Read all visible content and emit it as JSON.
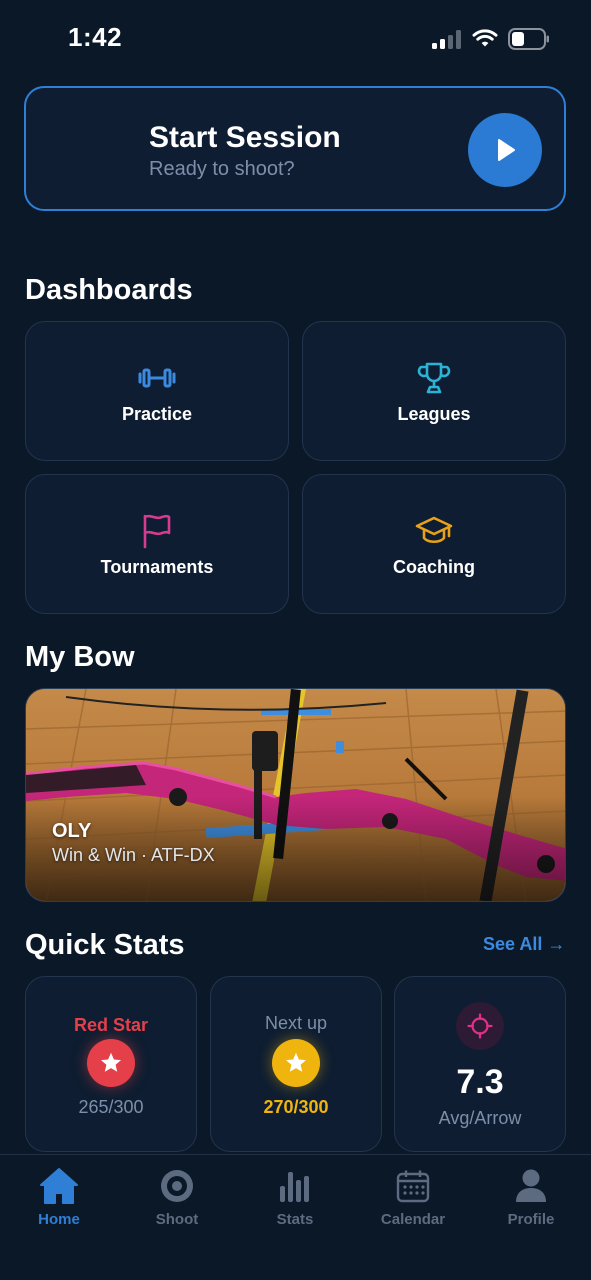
{
  "status_bar": {
    "time": "1:42"
  },
  "start_session": {
    "title": "Start Session",
    "subtitle": "Ready to shoot?"
  },
  "dashboards": {
    "title": "Dashboards",
    "items": [
      {
        "label": "Practice",
        "icon": "dumbbell-icon",
        "color": "#3b8ae0"
      },
      {
        "label": "Leagues",
        "icon": "trophy-icon",
        "color": "#2bb3d6"
      },
      {
        "label": "Tournaments",
        "icon": "flag-icon",
        "color": "#d63b8f"
      },
      {
        "label": "Coaching",
        "icon": "graduation-cap-icon",
        "color": "#e8a21a"
      }
    ]
  },
  "my_bow": {
    "title": "My Bow",
    "name": "OLY",
    "detail": "Win & Win · ATF-DX"
  },
  "quick_stats": {
    "title": "Quick Stats",
    "see_all": "See All →",
    "cards": [
      {
        "top": "Red Star",
        "bottom": "265/300",
        "top_color": "#e5404a",
        "badge_color": "#e5404a"
      },
      {
        "top": "Next up",
        "bottom": "270/300",
        "top_color": "#7d8fa8",
        "badge_color": "#f0b40e"
      },
      {
        "value": "7.3",
        "unit": "Avg/Arrow",
        "icon_color": "#e02f86"
      }
    ]
  },
  "tabs": [
    {
      "label": "Home",
      "icon": "home-icon",
      "active": true
    },
    {
      "label": "Shoot",
      "icon": "target-icon",
      "active": false
    },
    {
      "label": "Stats",
      "icon": "bar-chart-icon",
      "active": false
    },
    {
      "label": "Calendar",
      "icon": "calendar-icon",
      "active": false
    },
    {
      "label": "Profile",
      "icon": "profile-icon",
      "active": false
    }
  ],
  "colors": {
    "background": "#0b1828",
    "card": "#0e1d31",
    "accent": "#2f7fd6"
  }
}
